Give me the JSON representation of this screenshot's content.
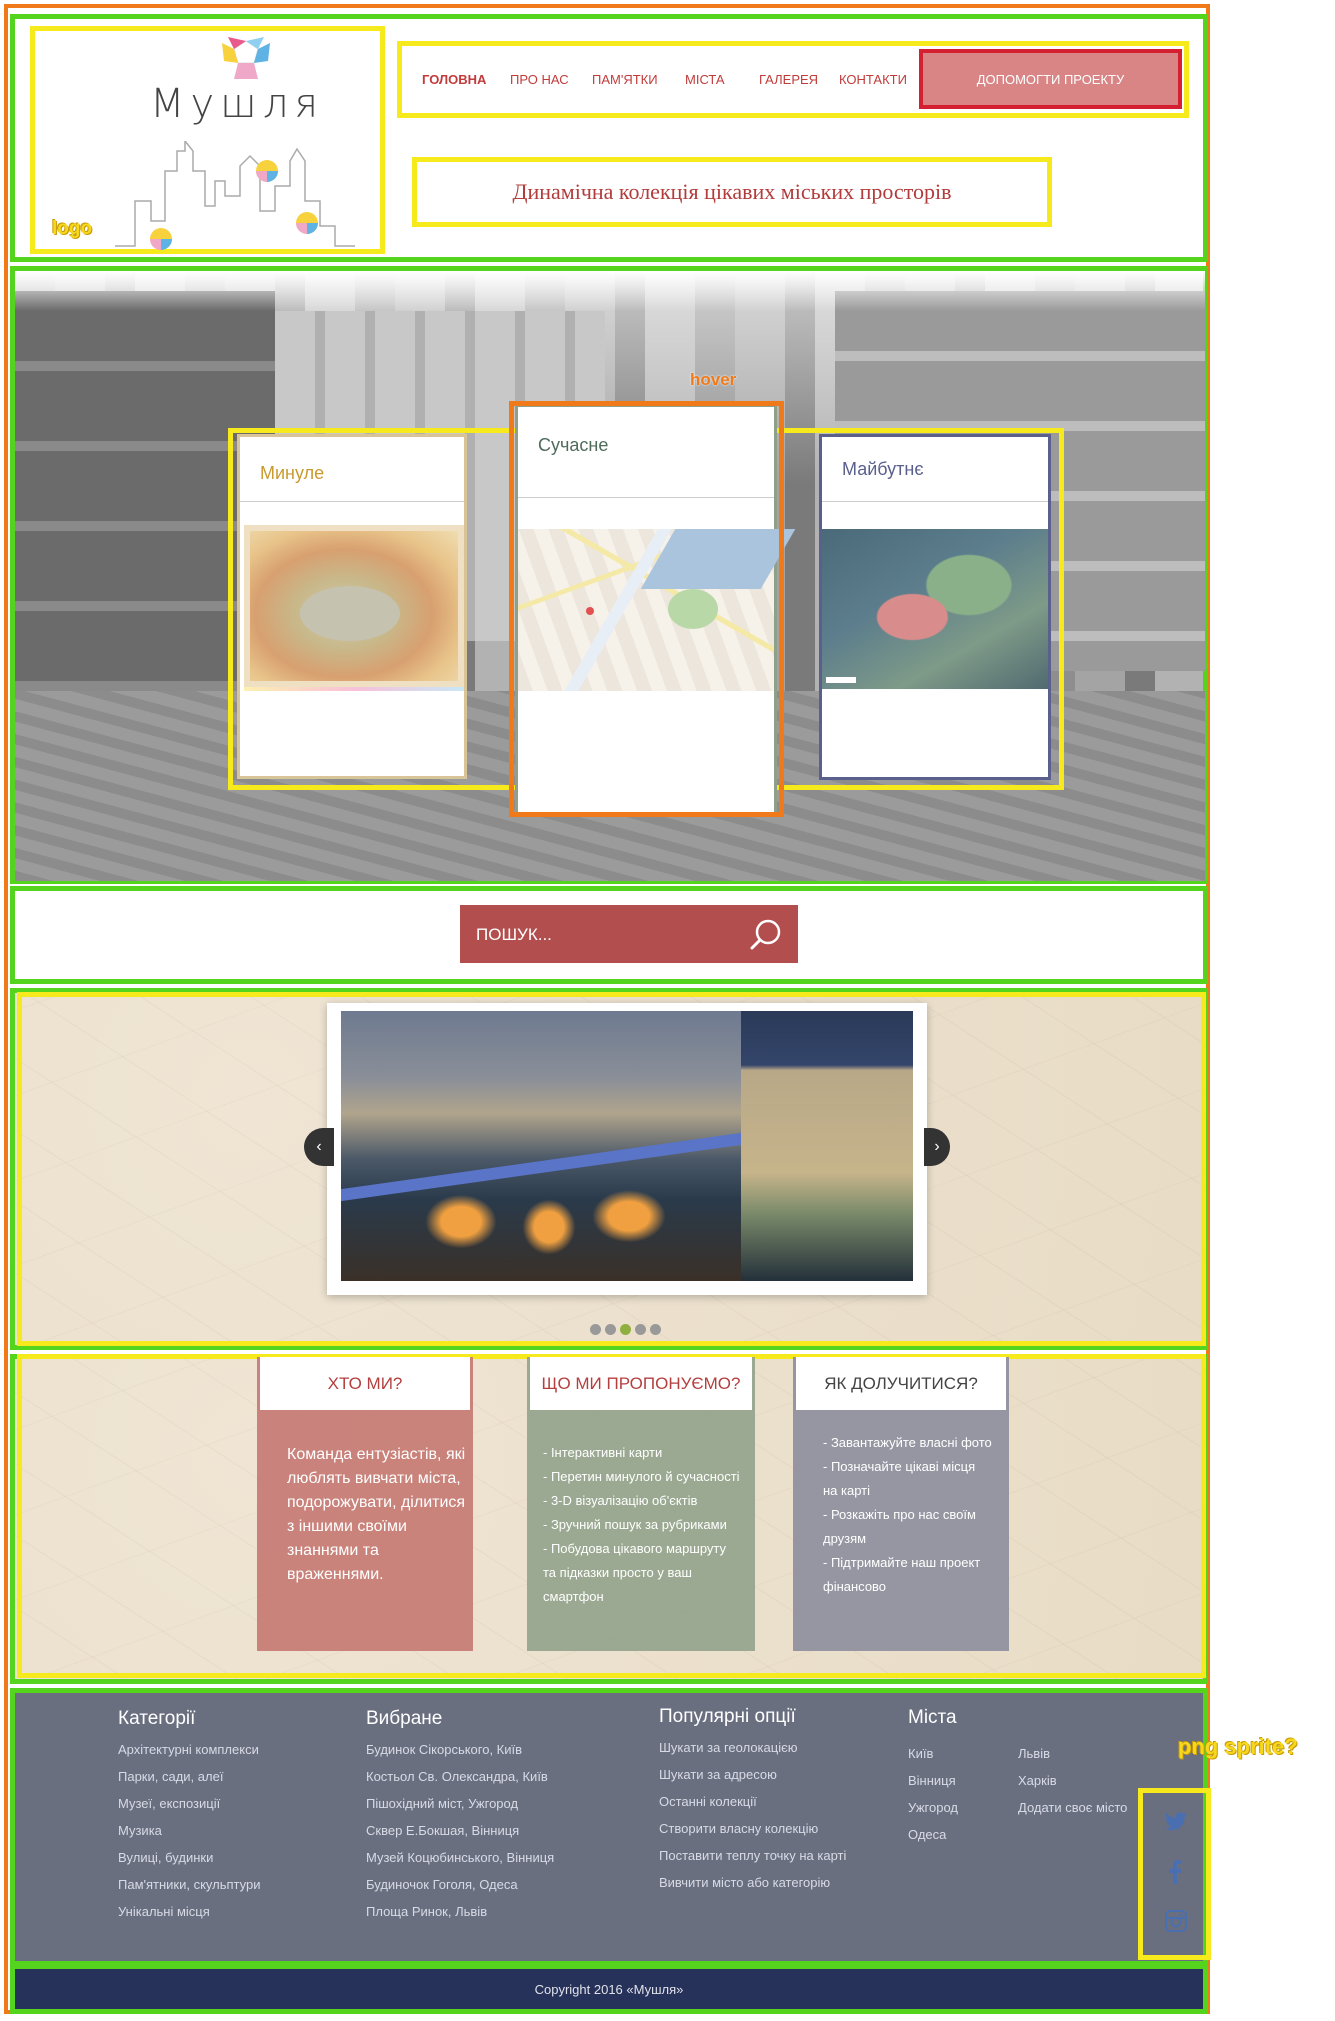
{
  "header": {
    "logo_text": "Мушля",
    "tagline": "Динамічна колекція цікавих міських просторів",
    "nav": [
      {
        "label": "ГОЛОВНА",
        "active": true
      },
      {
        "label": "ПРО НАС"
      },
      {
        "label": "ПАМ'ЯТКИ"
      },
      {
        "label": "МІСТА"
      },
      {
        "label": "ГАЛЕРЕЯ"
      },
      {
        "label": "КОНТАКТИ"
      }
    ],
    "donate_button": "ДОПОМОГТИ ПРОЕКТУ"
  },
  "annotations": {
    "logo": "logo",
    "hover": "hover",
    "sprite": "png sprite?"
  },
  "hero": {
    "cards": [
      {
        "title": "Минуле",
        "color": "#c99a2e"
      },
      {
        "title": "Сучасне",
        "color": "#4f6b5a"
      },
      {
        "title": "Майбутнє",
        "color": "#5a5f8c"
      }
    ]
  },
  "search": {
    "placeholder": "ПОШУК..."
  },
  "slider": {
    "dots": 5,
    "active_dot": 3
  },
  "info": {
    "who": {
      "title": "ХТО МИ?",
      "text": "Команда ентузіастів, які люблять вивчати міста, подорожувати, ділитися з іншими своїми знаннями та враженнями."
    },
    "offer": {
      "title": "ЩО МИ ПРОПОНУЄМО?",
      "items": [
        "- Інтерактивні карти",
        "- Перетин минулого й сучасності",
        "- 3-D візуалізацію об'єктів",
        "- Зручний пошук за рубриками",
        "- Побудова цікавого маршруту",
        "та підказки просто у ваш",
        "смартфон"
      ]
    },
    "join": {
      "title": "ЯК ДОЛУЧИТИСЯ?",
      "items": [
        "- Завантажуйте власні фото",
        "- Позначайте цікаві місця",
        "на карті",
        "- Розкажіть про нас своїм",
        "друзям",
        "- Підтримайте наш проект",
        "фінансово"
      ]
    }
  },
  "footer": {
    "categories": {
      "title": "Категорії",
      "items": [
        "Архітектурні комплекси",
        "Парки, сади, алеї",
        "Музеї, експозиції",
        "Музика",
        "Вулиці, будинки",
        "Пам'ятники, скульптури",
        "Унікальні місця"
      ]
    },
    "favorites": {
      "title": "Вибране",
      "items": [
        "Будинок Сікорського, Київ",
        "Костьол Св. Олександра, Київ",
        "Пішохідний міст, Ужгород",
        "Сквер Е.Бокшая, Вінниця",
        "Музей Коцюбинського, Вінниця",
        "Будиночок Гоголя, Одеса",
        "Площа Ринок, Львів"
      ]
    },
    "popular": {
      "title": "Популярні опції",
      "items": [
        "Шукати за геолокацією",
        "Шукати за адресою",
        "Останні колекції",
        "Створити власну колекцію",
        "Поставити теплу точку на карті",
        "Вивчити місто або категорію"
      ]
    },
    "cities": {
      "title": "Міста",
      "col1": [
        "Київ",
        "Вінниця",
        "Ужгород",
        "Одеса"
      ],
      "col2": [
        "Львів",
        "Харків",
        "Додати своє місто"
      ]
    },
    "social": [
      "twitter-icon",
      "facebook-icon",
      "instagram-icon"
    ],
    "copyright": "Copyright 2016 «Мушля»"
  },
  "colors": {
    "accent_red": "#b34e4e",
    "footer_bg": "#6a6f80",
    "copyright_bg": "#27325a",
    "who_bg": "#c2726c",
    "offer_bg": "#8fa08a",
    "join_bg": "#8d8e9d"
  }
}
